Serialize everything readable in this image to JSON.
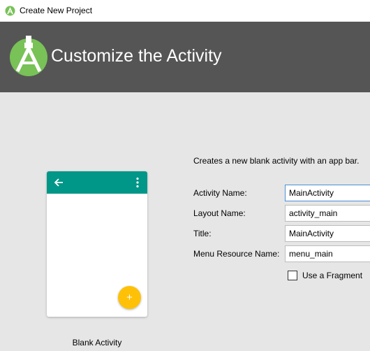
{
  "window": {
    "title": "Create New Project"
  },
  "header": {
    "title": "Customize the Activity"
  },
  "preview": {
    "template_name": "Blank Activity",
    "appbar_color": "#009688",
    "fab_color": "#ffc107",
    "fab_symbol": "+"
  },
  "form": {
    "description": "Creates a new blank activity with an app bar.",
    "fields": [
      {
        "label": "Activity Name:",
        "value": "MainActivity"
      },
      {
        "label": "Layout Name:",
        "value": "activity_main"
      },
      {
        "label": "Title:",
        "value": "MainActivity"
      },
      {
        "label": "Menu Resource Name:",
        "value": "menu_main"
      }
    ],
    "use_fragment": {
      "label": "Use a Fragment",
      "checked": false
    }
  },
  "colors": {
    "banner": "#555555",
    "android_green": "#78c257",
    "background": "#e6e6e6"
  }
}
